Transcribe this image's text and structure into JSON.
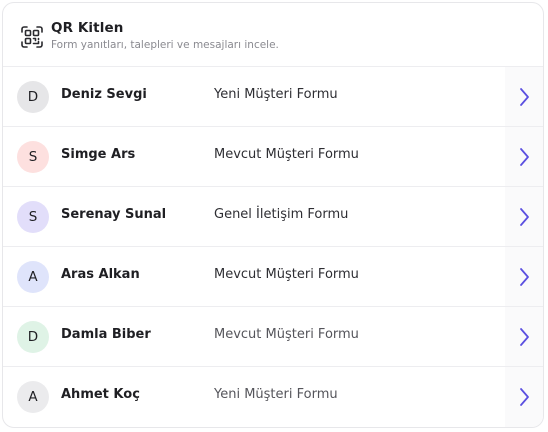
{
  "header": {
    "title": "QR Kitlen",
    "subtitle": "Form yanıtları, talepleri ve mesajları incele.",
    "icon": "qr-scan-icon"
  },
  "colors": {
    "accent": "#5b4fe0",
    "avatar_gray": "#e6e6e8",
    "avatar_pink": "#fde0df",
    "avatar_lavender": "#e2defa",
    "avatar_blue": "#dfe4fb",
    "avatar_green": "#dff3e6"
  },
  "rows": [
    {
      "initial": "D",
      "name": "Deniz Sevgi",
      "form": "Yeni Müşteri Formu",
      "avatar_color": "#e6e6e8"
    },
    {
      "initial": "S",
      "name": "Simge Ars",
      "form": "Mevcut Müşteri Formu",
      "avatar_color": "#fde0df"
    },
    {
      "initial": "S",
      "name": "Serenay Sunal",
      "form": "Genel İletişim Formu",
      "avatar_color": "#e2defa"
    },
    {
      "initial": "A",
      "name": "Aras Alkan",
      "form": "Mevcut Müşteri Formu",
      "avatar_color": "#dfe4fb"
    },
    {
      "initial": "D",
      "name": "Damla Biber",
      "form": "Mevcut Müşteri Formu",
      "avatar_color": "#dff3e6"
    },
    {
      "initial": "A",
      "name": "Ahmet Koç",
      "form": "Yeni Müşteri Formu",
      "avatar_color": "#ebebed"
    }
  ]
}
